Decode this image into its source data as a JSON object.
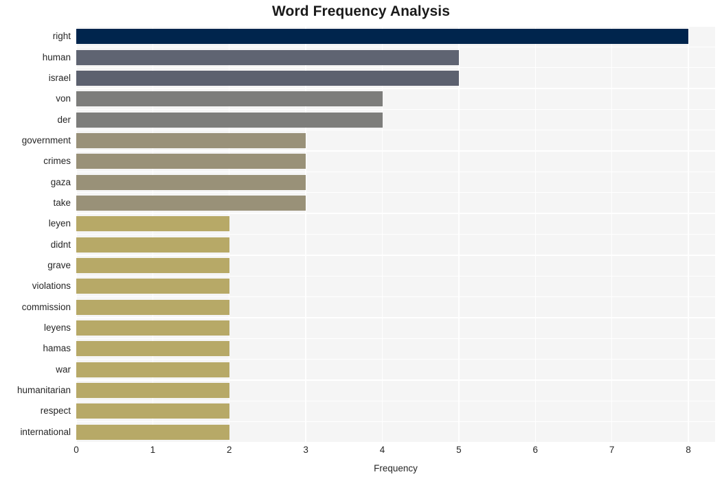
{
  "chart_data": {
    "type": "bar",
    "orientation": "horizontal",
    "title": "Word Frequency Analysis",
    "xlabel": "Frequency",
    "ylabel": "",
    "xlim": [
      0,
      8.35
    ],
    "ylim": null,
    "grid": true,
    "legend": null,
    "xticks": [
      "0",
      "1",
      "2",
      "3",
      "4",
      "5",
      "6",
      "7",
      "8"
    ],
    "xtick_values": [
      0,
      1,
      2,
      3,
      4,
      5,
      6,
      7,
      8
    ],
    "categories": [
      "right",
      "human",
      "israel",
      "von",
      "der",
      "government",
      "crimes",
      "gaza",
      "take",
      "leyen",
      "didnt",
      "grave",
      "violations",
      "commission",
      "leyens",
      "hamas",
      "war",
      "humanitarian",
      "respect",
      "international"
    ],
    "values": [
      8,
      5,
      5,
      4,
      4,
      3,
      3,
      3,
      3,
      2,
      2,
      2,
      2,
      2,
      2,
      2,
      2,
      2,
      2,
      2
    ],
    "bar_colors": [
      "#00254d",
      "#5f6472",
      "#5c616f",
      "#7d7d7b",
      "#7d7d7b",
      "#999179",
      "#999178",
      "#999178",
      "#999178",
      "#b7a967",
      "#b7a967",
      "#b7a967",
      "#b7a967",
      "#b7a967",
      "#b7a967",
      "#b7a967",
      "#b7a967",
      "#b7a967",
      "#b7a967",
      "#b7a967"
    ]
  },
  "style": {
    "plot_background": "#f5f5f5",
    "figure_background": "#ffffff",
    "gridline_color": "#ffffff",
    "text_color": "#262626"
  }
}
